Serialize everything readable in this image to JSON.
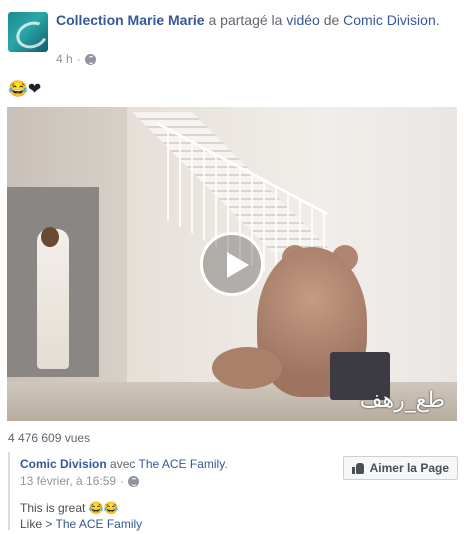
{
  "post": {
    "author": "Collection Marie Marie",
    "shared_text": "a partagé la",
    "video_word": "vidéo",
    "de_word": "de",
    "source": "Comic Division",
    "period": ".",
    "time": "4 h",
    "separator": "·",
    "status": "😂❤"
  },
  "video": {
    "watermark": "طع_رهف",
    "views": "4 476 609 vues"
  },
  "shared_post": {
    "page": "Comic Division",
    "with_word": "avec",
    "tagged": "The ACE Family",
    "period": ".",
    "date": "13 février, à 16:59",
    "separator": "·",
    "like_button": "Aimer la Page",
    "text": "This is great 😂😂",
    "like_prefix": "Like >",
    "like_target": "The ACE Family"
  }
}
